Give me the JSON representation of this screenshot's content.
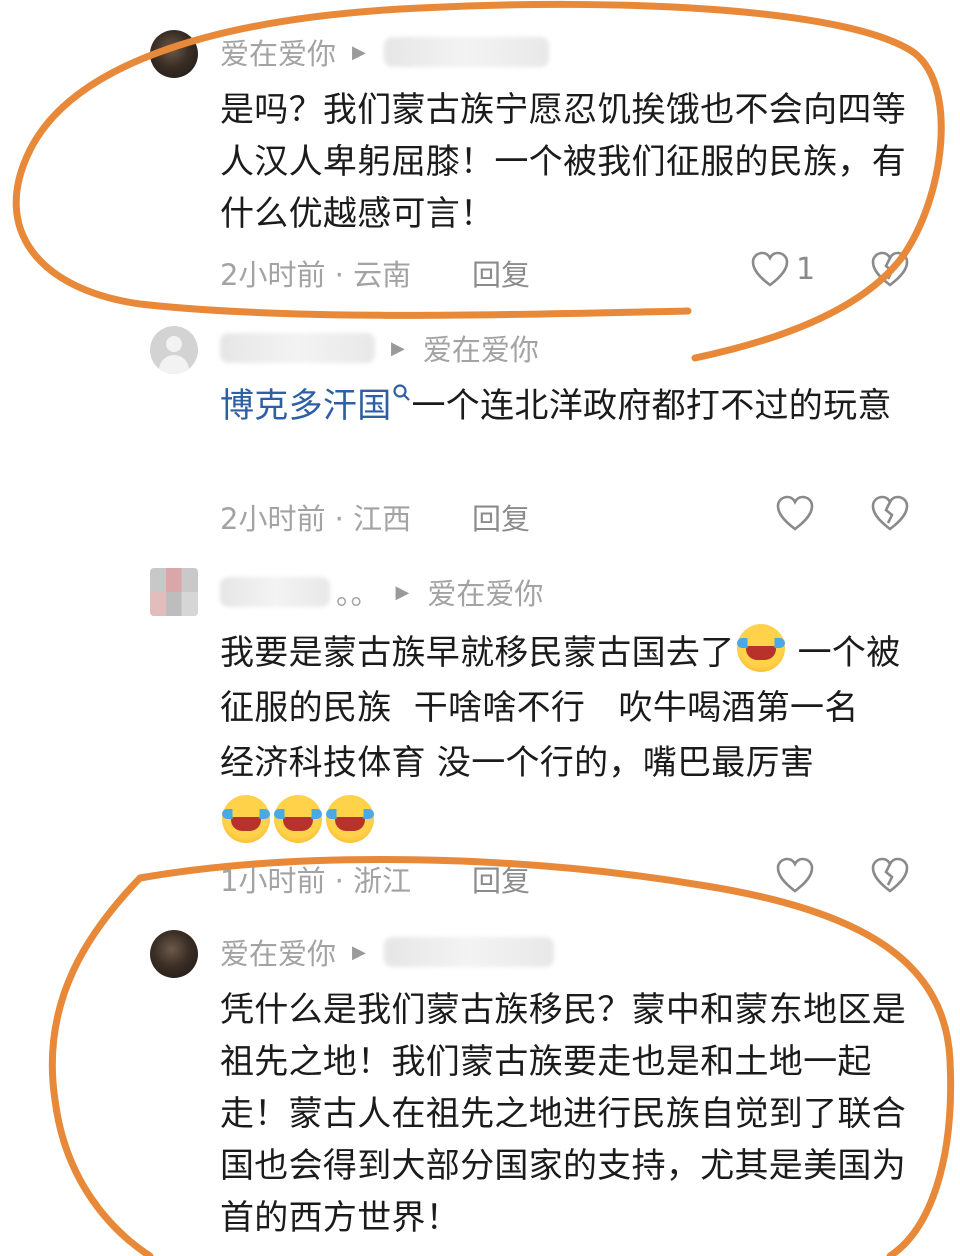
{
  "comments": [
    {
      "author": "爱在爱你",
      "text": "是吗？我们蒙古族宁愿忍饥挨饿也不会向四等人汉人卑躬屈膝！一个被我们征服的民族，有什么优越感可言！",
      "time": "2小时前 · 云南",
      "reply": "回复",
      "likes": "1"
    },
    {
      "reply_to": "爱在爱你",
      "link_text": "博克多汗国",
      "text": "一个连北洋政府都打不过的玩意",
      "time": "2小时前 · 江西",
      "reply": "回复"
    },
    {
      "author_suffix": "。。",
      "reply_to": "爱在爱你",
      "text_a": "我要是蒙古族早就移民蒙古国去了",
      "text_b": " 一个被征服的民族  干啥啥不行   吹牛喝酒第一名   经济科技体育 没一个行的，嘴巴最厉害",
      "time": "1小时前 · 浙江",
      "reply": "回复"
    },
    {
      "author": "爱在爱你",
      "text": "凭什么是我们蒙古族移民？蒙中和蒙东地区是祖先之地！我们蒙古族要走也是和土地一起走！蒙古人在祖先之地进行民族自觉到了联合国也会得到大部分国家的支持，尤其是美国为首的西方世界！"
    }
  ],
  "icons": {
    "like": "heart-outline-icon",
    "dislike": "broken-heart-icon",
    "reply_arrow": "play-triangle-icon",
    "emoji": "rolling-laughing-emoji"
  },
  "colors": {
    "annotation": "#e8893a",
    "link": "#2f5fa3",
    "meta": "#a3a3a3"
  }
}
